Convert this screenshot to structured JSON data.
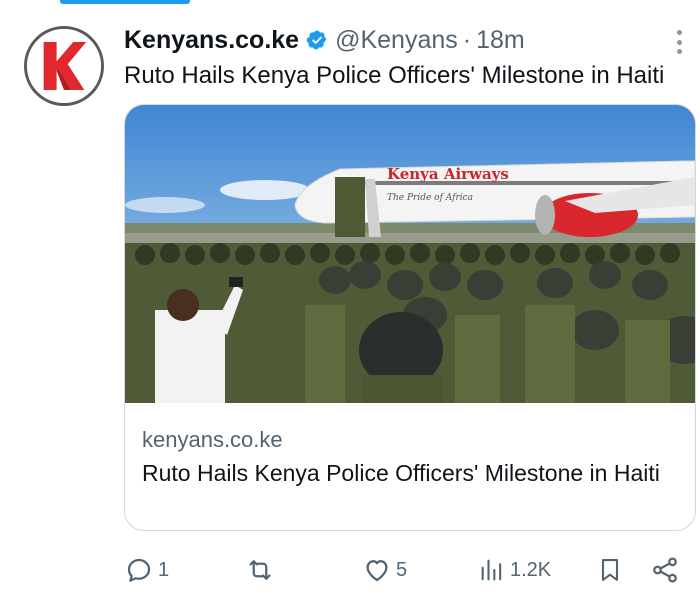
{
  "tweet": {
    "author_name": "Kenyans.co.ke",
    "handle": "@Kenyans",
    "separator": "·",
    "time": "18m",
    "text": "Ruto Hails Kenya Police Officers' Milestone in Haiti",
    "verified_icon": "verified-badge-icon",
    "avatar_icon": "kenyans-k-logo"
  },
  "card": {
    "domain": "kenyans.co.ke",
    "title": "Ruto Hails Kenya Police Officers' Milestone in Haiti",
    "image_description": "kenya-police-officers-at-airport-photo",
    "plane_livery_text": "Kenya Airways",
    "plane_tagline": "The Pride of Africa"
  },
  "actions": {
    "reply_count": "1",
    "repost_count": "",
    "like_count": "5",
    "views_count": "1.2K"
  },
  "colors": {
    "accent": "#1d9bf0",
    "muted_text": "#536471",
    "text": "#0f1419",
    "brand_red": "#e0282e"
  }
}
